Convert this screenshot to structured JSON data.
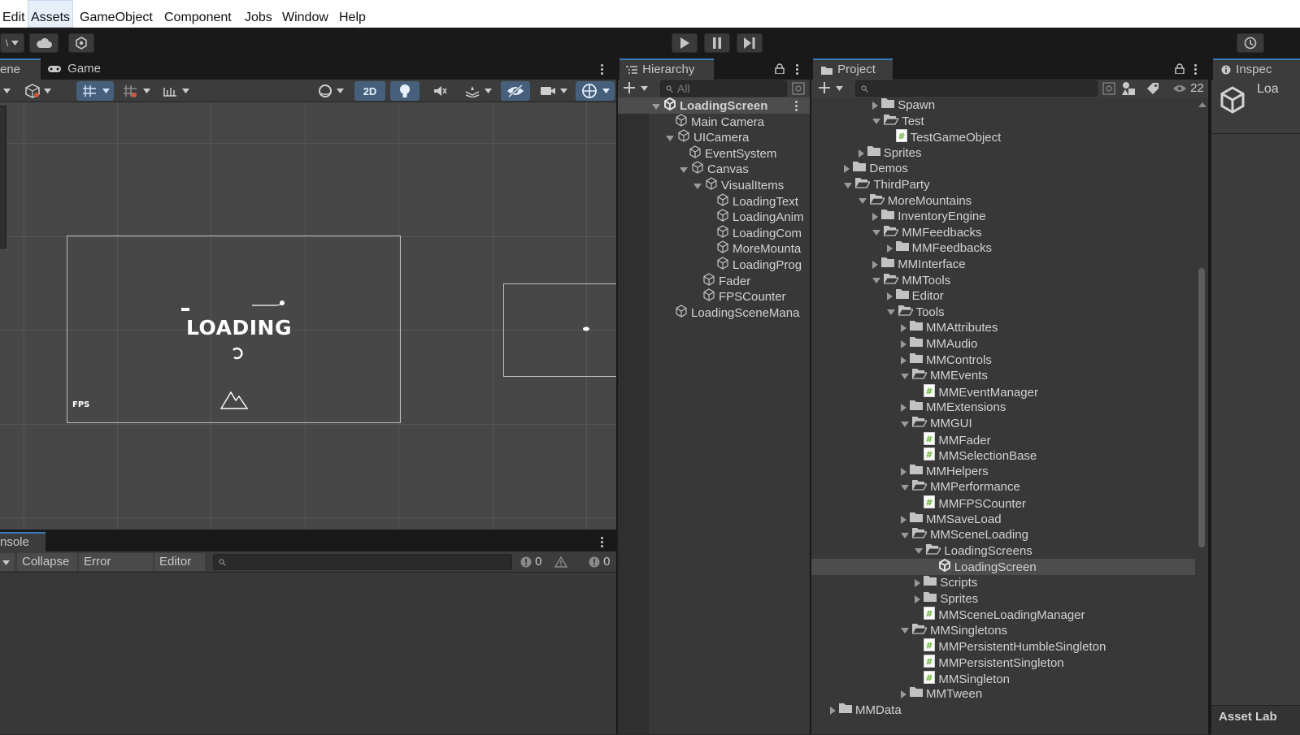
{
  "menubar": {
    "items": [
      "Edit",
      "Assets",
      "GameObject",
      "Component",
      "Jobs",
      "Window",
      "Help"
    ],
    "active_index": 1
  },
  "toolbar": {
    "account_dropdown": "\\",
    "play_icon": "play-icon",
    "pause_icon": "pause-icon",
    "step_icon": "step-icon"
  },
  "scene": {
    "tabs": [
      "ene",
      "Game"
    ],
    "toolbar_2d_label": "2D",
    "preview": {
      "loading_text": "LOADING",
      "fps_text": "FPS"
    }
  },
  "console": {
    "tab_label": "nsole",
    "buttons": {
      "collapse": "Collapse",
      "error_pause": "Error Pause",
      "editor": "Editor"
    },
    "counts": {
      "log": "0",
      "warning": "0",
      "error": "0"
    }
  },
  "hierarchy": {
    "tab_label": "Hierarchy",
    "search_placeholder": "All",
    "rows": [
      {
        "label": "LoadingScreen",
        "indent": 0,
        "arrow": "down",
        "icon": "unity-scene-icon",
        "bold": true,
        "selected": true,
        "menu": true
      },
      {
        "label": "Main Camera",
        "indent": 1,
        "arrow": "none",
        "icon": "gameobject-icon"
      },
      {
        "label": "UICamera",
        "indent": 1,
        "arrow": "down",
        "icon": "gameobject-icon"
      },
      {
        "label": "EventSystem",
        "indent": 2,
        "arrow": "none",
        "icon": "gameobject-icon"
      },
      {
        "label": "Canvas",
        "indent": 2,
        "arrow": "down",
        "icon": "gameobject-icon"
      },
      {
        "label": "VisualItems",
        "indent": 3,
        "arrow": "down",
        "icon": "gameobject-icon"
      },
      {
        "label": "LoadingText",
        "indent": 4,
        "arrow": "none",
        "icon": "gameobject-icon"
      },
      {
        "label": "LoadingAnim",
        "indent": 4,
        "arrow": "none",
        "icon": "gameobject-icon"
      },
      {
        "label": "LoadingCom",
        "indent": 4,
        "arrow": "none",
        "icon": "gameobject-icon"
      },
      {
        "label": "MoreMounta",
        "indent": 4,
        "arrow": "none",
        "icon": "gameobject-icon"
      },
      {
        "label": "LoadingProg",
        "indent": 4,
        "arrow": "none",
        "icon": "gameobject-icon"
      },
      {
        "label": "Fader",
        "indent": 3,
        "arrow": "none",
        "icon": "gameobject-icon"
      },
      {
        "label": "FPSCounter",
        "indent": 3,
        "arrow": "none",
        "icon": "gameobject-icon"
      },
      {
        "label": "LoadingSceneMana",
        "indent": 1,
        "arrow": "none",
        "icon": "gameobject-icon"
      }
    ]
  },
  "project": {
    "tab_label": "Project",
    "hidden_count": "22",
    "rows": [
      {
        "label": "Spawn",
        "depth": 4,
        "arrow": "right",
        "icon": "folder-icon"
      },
      {
        "label": "Test",
        "depth": 4,
        "arrow": "down",
        "icon": "folder-open-icon"
      },
      {
        "label": "TestGameObject",
        "depth": 5,
        "arrow": "none",
        "icon": "script-icon"
      },
      {
        "label": "Sprites",
        "depth": 3,
        "arrow": "right",
        "icon": "folder-icon"
      },
      {
        "label": "Demos",
        "depth": 2,
        "arrow": "right",
        "icon": "folder-icon"
      },
      {
        "label": "ThirdParty",
        "depth": 2,
        "arrow": "down",
        "icon": "folder-open-icon"
      },
      {
        "label": "MoreMountains",
        "depth": 3,
        "arrow": "down",
        "icon": "folder-open-icon"
      },
      {
        "label": "InventoryEngine",
        "depth": 4,
        "arrow": "right",
        "icon": "folder-icon"
      },
      {
        "label": "MMFeedbacks",
        "depth": 4,
        "arrow": "down",
        "icon": "folder-open-icon"
      },
      {
        "label": "MMFeedbacks",
        "depth": 5,
        "arrow": "right",
        "icon": "folder-icon"
      },
      {
        "label": "MMInterface",
        "depth": 4,
        "arrow": "right",
        "icon": "folder-icon"
      },
      {
        "label": "MMTools",
        "depth": 4,
        "arrow": "down",
        "icon": "folder-open-icon"
      },
      {
        "label": "Editor",
        "depth": 5,
        "arrow": "right",
        "icon": "folder-icon"
      },
      {
        "label": "Tools",
        "depth": 5,
        "arrow": "down",
        "icon": "folder-open-icon"
      },
      {
        "label": "MMAttributes",
        "depth": 6,
        "arrow": "right",
        "icon": "folder-icon"
      },
      {
        "label": "MMAudio",
        "depth": 6,
        "arrow": "right",
        "icon": "folder-icon"
      },
      {
        "label": "MMControls",
        "depth": 6,
        "arrow": "right",
        "icon": "folder-icon"
      },
      {
        "label": "MMEvents",
        "depth": 6,
        "arrow": "down",
        "icon": "folder-open-icon"
      },
      {
        "label": "MMEventManager",
        "depth": 7,
        "arrow": "none",
        "icon": "script-icon"
      },
      {
        "label": "MMExtensions",
        "depth": 6,
        "arrow": "right",
        "icon": "folder-icon"
      },
      {
        "label": "MMGUI",
        "depth": 6,
        "arrow": "down",
        "icon": "folder-open-icon"
      },
      {
        "label": "MMFader",
        "depth": 7,
        "arrow": "none",
        "icon": "script-icon"
      },
      {
        "label": "MMSelectionBase",
        "depth": 7,
        "arrow": "none",
        "icon": "script-icon"
      },
      {
        "label": "MMHelpers",
        "depth": 6,
        "arrow": "right",
        "icon": "folder-icon"
      },
      {
        "label": "MMPerformance",
        "depth": 6,
        "arrow": "down",
        "icon": "folder-open-icon"
      },
      {
        "label": "MMFPSCounter",
        "depth": 7,
        "arrow": "none",
        "icon": "script-icon"
      },
      {
        "label": "MMSaveLoad",
        "depth": 6,
        "arrow": "right",
        "icon": "folder-icon"
      },
      {
        "label": "MMSceneLoading",
        "depth": 6,
        "arrow": "down",
        "icon": "folder-open-icon"
      },
      {
        "label": "LoadingScreens",
        "depth": 7,
        "arrow": "down",
        "icon": "folder-open-icon"
      },
      {
        "label": "LoadingScreen",
        "depth": 8,
        "arrow": "none",
        "icon": "unity-scene-icon",
        "selected": true
      },
      {
        "label": "Scripts",
        "depth": 7,
        "arrow": "right",
        "icon": "folder-icon"
      },
      {
        "label": "Sprites",
        "depth": 7,
        "arrow": "right",
        "icon": "folder-icon"
      },
      {
        "label": "MMSceneLoadingManager",
        "depth": 7,
        "arrow": "none",
        "icon": "script-icon"
      },
      {
        "label": "MMSingletons",
        "depth": 6,
        "arrow": "down",
        "icon": "folder-open-icon"
      },
      {
        "label": "MMPersistentHumbleSingleton",
        "depth": 7,
        "arrow": "none",
        "icon": "script-icon"
      },
      {
        "label": "MMPersistentSingleton",
        "depth": 7,
        "arrow": "none",
        "icon": "script-icon"
      },
      {
        "label": "MMSingleton",
        "depth": 7,
        "arrow": "none",
        "icon": "script-icon"
      },
      {
        "label": "MMTween",
        "depth": 6,
        "arrow": "right",
        "icon": "folder-icon"
      },
      {
        "label": "MMData",
        "depth": 1,
        "arrow": "right",
        "icon": "folder-icon"
      }
    ]
  },
  "inspector": {
    "tab_label": "Inspec",
    "object_label": "Loa",
    "asset_labels": "Asset Lab"
  },
  "colors": {
    "selection_blue": "#3a79bb",
    "script_green": "#6fb23e",
    "panel_bg": "#383838"
  }
}
